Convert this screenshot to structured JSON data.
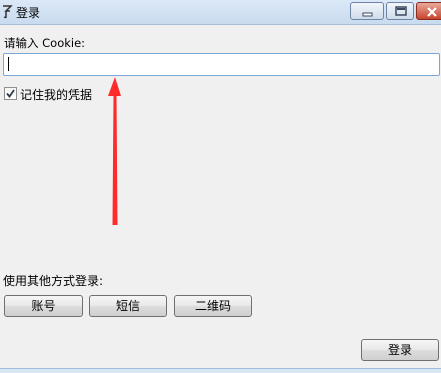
{
  "window": {
    "title": "登录",
    "app_icon": "app-icon"
  },
  "cookie": {
    "label": "请输入 Cookie:",
    "value": "",
    "placeholder": ""
  },
  "remember": {
    "label": "记住我的凭据",
    "checked": true
  },
  "annotation": {
    "arrow_color": "#ff2a2a"
  },
  "other_methods": {
    "label": "使用其他方式登录:",
    "buttons": [
      "账号",
      "短信",
      "二维码"
    ]
  },
  "actions": {
    "login_label": "登录"
  }
}
